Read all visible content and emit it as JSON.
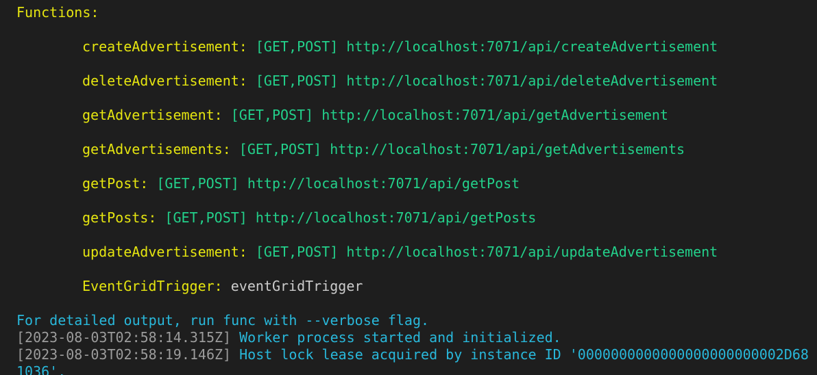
{
  "colors": {
    "background": "#1e1e1e",
    "name": "#e5e510",
    "route": "#23d18b",
    "trigger": "#cccccc",
    "info": "#29b8db",
    "timestamp": "#9c9c9c"
  },
  "header": "Functions:",
  "functions": [
    {
      "name": "createAdvertisement:",
      "methods": "[GET,POST]",
      "url": "http://localhost:7071/api/createAdvertisement"
    },
    {
      "name": "deleteAdvertisement:",
      "methods": "[GET,POST]",
      "url": "http://localhost:7071/api/deleteAdvertisement"
    },
    {
      "name": "getAdvertisement:",
      "methods": "[GET,POST]",
      "url": "http://localhost:7071/api/getAdvertisement"
    },
    {
      "name": "getAdvertisements:",
      "methods": "[GET,POST]",
      "url": "http://localhost:7071/api/getAdvertisements"
    },
    {
      "name": "getPost:",
      "methods": "[GET,POST]",
      "url": "http://localhost:7071/api/getPost"
    },
    {
      "name": "getPosts:",
      "methods": "[GET,POST]",
      "url": "http://localhost:7071/api/getPosts"
    },
    {
      "name": "updateAdvertisement:",
      "methods": "[GET,POST]",
      "url": "http://localhost:7071/api/updateAdvertisement"
    }
  ],
  "trigger": {
    "name": "EventGridTrigger:",
    "type": "eventGridTrigger"
  },
  "info": "For detailed output, run func with --verbose flag.",
  "logs": [
    {
      "timestamp": "[2023-08-03T02:58:14.315Z]",
      "message": "Worker process started and initialized."
    },
    {
      "timestamp": "[2023-08-03T02:58:19.146Z]",
      "message": "Host lock lease acquired by instance ID '0000000000000000000000002D68"
    }
  ],
  "log_continuation": "1036'."
}
